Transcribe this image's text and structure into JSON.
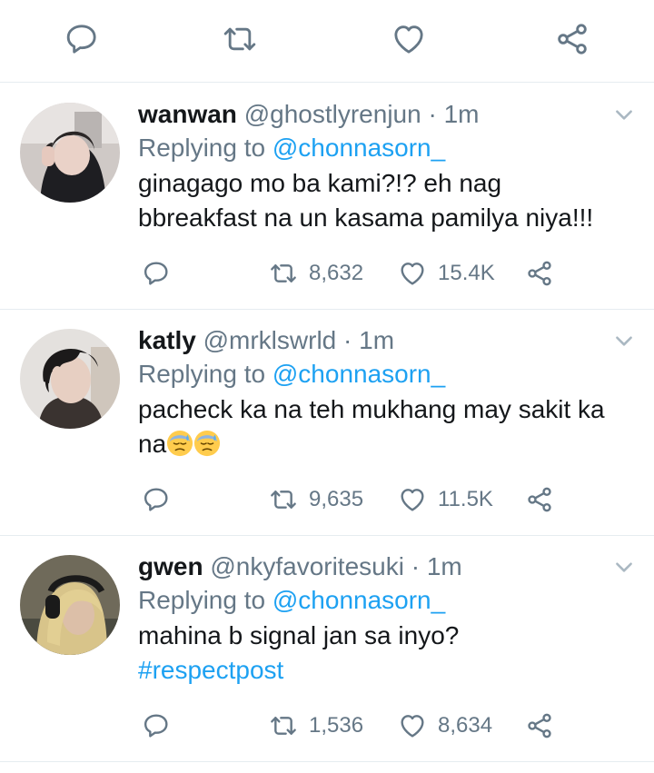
{
  "action_bar": {
    "icons": [
      "reply-icon",
      "retweet-icon",
      "like-icon",
      "share-icon"
    ]
  },
  "replying_prefix": "Replying to",
  "tweets": [
    {
      "name": "wanwan",
      "handle": "@ghostlyrenjun",
      "dot": "·",
      "time": "1m",
      "reply_to": "@chonnasorn_",
      "text_line1": "ginagago mo ba kami?!? eh nag",
      "text_line2": "bbreakfast na un kasama pamilya niya!!!",
      "retweets": "8,632",
      "likes": "15.4K"
    },
    {
      "name": "katly",
      "handle": "@mrklswrld",
      "dot": "·",
      "time": "1m",
      "reply_to": "@chonnasorn_",
      "text_line1": "pacheck ka na teh mukhang may sakit ka",
      "text_line2": "na",
      "emoji": [
        "downcast-face-with-sweat",
        "downcast-face-with-sweat"
      ],
      "retweets": "9,635",
      "likes": "11.5K"
    },
    {
      "name": "gwen",
      "handle": "@nkyfavoritesuki",
      "dot": "·",
      "time": "1m",
      "reply_to": "@chonnasorn_",
      "text_line1": "mahina b signal jan sa inyo?",
      "hashtag": "#respectpost",
      "retweets": "1,536",
      "likes": "8,634"
    }
  ],
  "colors": {
    "link": "#1da1f2",
    "muted": "#657786",
    "text": "#14171a",
    "divider": "#e6ecf0"
  }
}
